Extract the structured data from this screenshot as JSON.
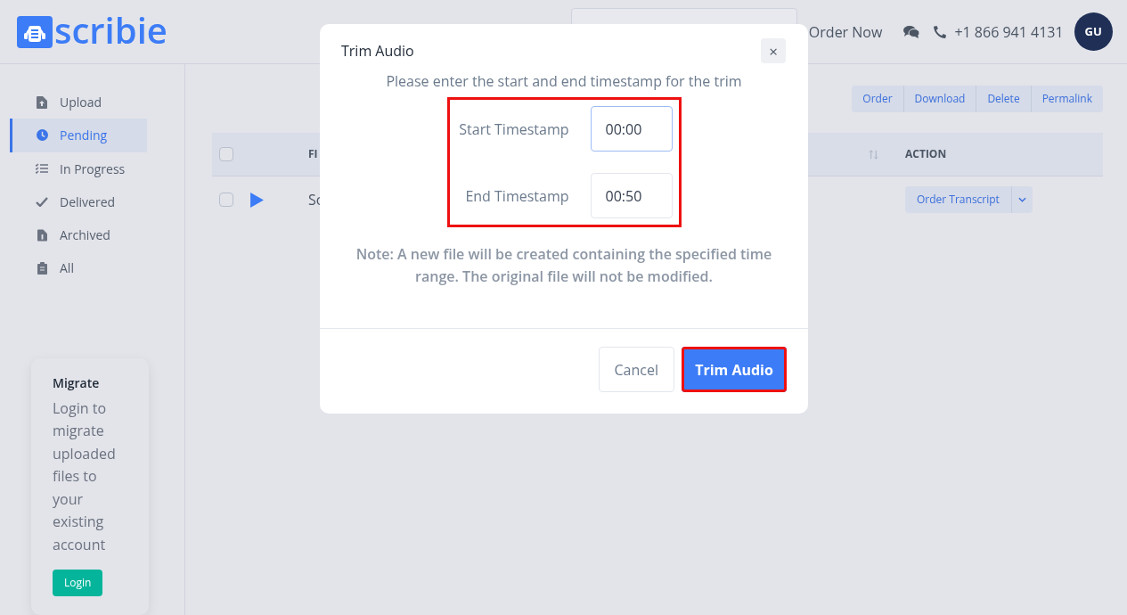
{
  "header": {
    "logo_text": "scribie",
    "order_now": "Order Now",
    "phone": "+1 866 941 4131",
    "avatar_initials": "GU"
  },
  "sidebar": {
    "items": [
      {
        "label": "Upload",
        "kind": "upload",
        "selected": false
      },
      {
        "label": "Pending",
        "kind": "clock",
        "selected": true
      },
      {
        "label": "In Progress",
        "kind": "list",
        "selected": false
      },
      {
        "label": "Delivered",
        "kind": "check",
        "selected": false
      },
      {
        "label": "Archived",
        "kind": "file",
        "selected": false
      },
      {
        "label": "All",
        "kind": "clipboard",
        "selected": false
      }
    ]
  },
  "migrate": {
    "title": "Migrate",
    "text": "Login to migrate uploaded files to your existing account",
    "button": "Login"
  },
  "toolbar": {
    "buttons": [
      "Order",
      "Download",
      "Delete",
      "Permalink"
    ]
  },
  "table": {
    "all_checked": false,
    "columns": [
      "FI",
      "ACTION"
    ],
    "rows": [
      {
        "checked": false,
        "file": "Sc",
        "action": "Order Transcript"
      }
    ]
  },
  "dialog": {
    "title": "Trim Audio",
    "close": "×",
    "description": "Please enter the start and end timestamp for the trim",
    "fields_highlighted": true,
    "fields": [
      {
        "label": "Start Timestamp",
        "value": "00:00",
        "focused": true
      },
      {
        "label": "End Timestamp",
        "value": "00:50",
        "focused": false
      }
    ],
    "note": "Note: A new file will be created containing the specified time range. The original file will not be modified.",
    "buttons": [
      {
        "label": "Cancel",
        "kind": "secondary",
        "highlighted": false
      },
      {
        "label": "Trim Audio",
        "kind": "primary",
        "highlighted": true
      }
    ]
  }
}
